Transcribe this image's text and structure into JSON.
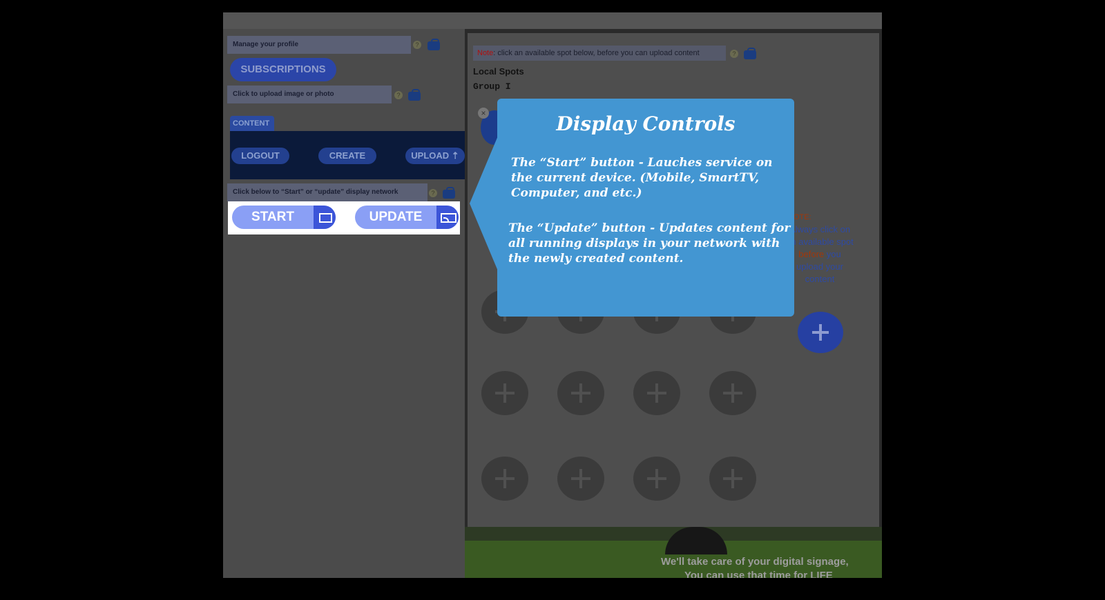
{
  "left_panel": {
    "profile_bar": "Manage your profile",
    "subscriptions_label": "SUBSCRIPTIONS",
    "upload_bar": "Click to upload image or photo",
    "content_tab": "CONTENT",
    "logout_label": "LOGOUT",
    "create_label": "CREATE",
    "upload_label": "UPLOAD",
    "network_bar": "Click below to “Start” or “update” display  network",
    "start_label": "START",
    "update_label": "UPDATE",
    "help_glyph": "?"
  },
  "right_panel": {
    "note_prefix": "Note",
    "note_text": ": click an available spot below, before you can upload content",
    "local_spots": "Local Spots",
    "group": "Group I",
    "side_note": {
      "heading": "NOTE:",
      "line1": "Always click on an available spot",
      "before": "before",
      "line2": "you upload your content"
    }
  },
  "banner": {
    "line1": "We'll take care of your digital signage,",
    "line2": "You can use that time for LIFE"
  },
  "popup": {
    "close_glyph": "×",
    "title": "Display Controls",
    "start_desc": "The “Start” button - Lauches service on the current device. (Mobile, SmartTV, Computer, and etc.)",
    "update_desc": "The “Update” button - Updates content for all running displays in your network with the newly created content."
  }
}
